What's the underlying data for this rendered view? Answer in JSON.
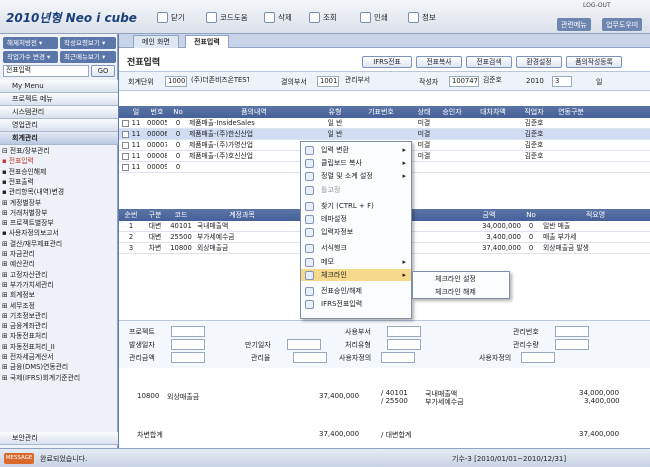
{
  "app": {
    "logo": "2010년형 Neo i cube",
    "logout": "LOG-OUT",
    "toolbar": [
      "닫기",
      "코드도움",
      "삭제",
      "조회",
      "인쇄",
      "정보"
    ],
    "header_buttons": [
      "관련메뉴",
      "업무도우미"
    ]
  },
  "sidebar": {
    "buttons": [
      "해제처방전 ▾",
      "작성요령보기 ▾",
      "작업가수 변경 ▾",
      "최근메뉴보기 ▾"
    ],
    "search_value": "전표입력",
    "go": "GO",
    "nav": [
      "My Menu",
      "프로젝트 메뉴",
      "시스템관리",
      "영업관리",
      "회계관리"
    ],
    "tree": [
      "⊟ 전표/장부관리",
      "  ▪ 전표입력",
      "  ▪ 전표승인해제",
      "  ▪ 전표출력",
      "  ▪ 관리항목(내역)변경",
      "⊞ 계정별장부",
      "⊞ 거래처별장부",
      "⊞ 프로젝트별장부",
      "  ▪ 사용자정의보고서",
      "⊞ 결산/재무제표관리",
      "⊞ 자금관리",
      "⊞ 예산관리",
      "⊞ 고정자산관리",
      "⊞ 부가가치세관리",
      "⊞ 회계정보",
      "⊞ 세무조정",
      "⊞ 기초정보관리",
      "⊞ 금융계좌관리",
      "⊞ 자동전표처리",
      "⊞ 자동전표처리_II",
      "⊞ 전자세금계산서",
      "⊞ 금융(DMS)연동관리",
      "⊞ 국제(IFRS)회계기준관리"
    ],
    "bottom": "보안관리"
  },
  "tabs": [
    "메인 화면",
    "전표입력"
  ],
  "page_title": "전표입력",
  "action_buttons": [
    "IFRS전표",
    "전표복사",
    "전표검색",
    "환경설정",
    "품의작성등록"
  ],
  "filters": {
    "unit_label": "회계단위",
    "unit_code": "1000",
    "unit_name": "(주)더존비즈온TEST",
    "dept_label": "결의부서",
    "dept_code": "1001",
    "dept_name": "관리부서",
    "writer_label": "작성자",
    "writer_code": "100747",
    "writer_name": "김준호",
    "year": "2010",
    "month": "3",
    "day_label": "일"
  },
  "top_grid": {
    "headers": [
      "일",
      "번호",
      "No",
      "품의내역",
      "유형",
      "기표번호",
      "상태",
      "승인자",
      "대차차액",
      "작업자",
      "연동구분"
    ],
    "rows": [
      [
        "11",
        "00005",
        "0",
        "제품매출-InsideSales",
        "일 반",
        "",
        "미결",
        "",
        "",
        "김준호",
        ""
      ],
      [
        "11",
        "00006",
        "0",
        "제품매출-(주)한신산업",
        "일 반",
        "",
        "미결",
        "",
        "",
        "김준호",
        ""
      ],
      [
        "11",
        "00007",
        "0",
        "제품매출-(주)가영산업",
        "일 반",
        "",
        "미결",
        "",
        "",
        "김준호",
        ""
      ],
      [
        "11",
        "00008",
        "0",
        "제품매출-(주)호신산업",
        "일 반",
        "",
        "미결",
        "",
        "",
        "김준호",
        ""
      ],
      [
        "11",
        "00009",
        "0",
        "",
        "",
        "",
        "",
        "",
        "",
        "",
        ""
      ]
    ]
  },
  "detail_grid": {
    "headers": [
      "순번",
      "구분",
      "코드",
      "계정과목",
      "",
      "금액",
      "No",
      "적요명"
    ],
    "rows": [
      [
        "1",
        "대변",
        "40101",
        "국내매출액",
        "",
        "34,000,000",
        "0",
        "일반 매출"
      ],
      [
        "2",
        "대변",
        "25500",
        "부가세예수금",
        "",
        "3,400,000",
        "0",
        "매출 부가세"
      ],
      [
        "3",
        "차변",
        "10800",
        "외상매출금",
        "",
        "37,400,000",
        "0",
        "외상매출금 발생"
      ]
    ]
  },
  "context_menu": [
    "입력 변환",
    "클립보드 복사",
    "정렬 및 소계 설정",
    "틀고정",
    "찾기 (CTRL + F)",
    "테마설정",
    "입력자정보",
    "서식행크",
    "메모",
    "체크라인",
    "전표승인/해제",
    "IFRS전표입력"
  ],
  "submenu": [
    "체크라인 설정",
    "체크라인 해제"
  ],
  "form_labels": [
    "프로젝트",
    "사용부서",
    "관리번호",
    "발생일자",
    "만기일자",
    "처리유형",
    "관리수량",
    "관리금액",
    "관리율",
    "사용자정의",
    "사용자정의"
  ],
  "summary": {
    "code": "10800",
    "name": "외상매출금",
    "amount": "37,400,000",
    "code2": "/ 40101",
    "code3": "/ 25500",
    "acct2": "국내매출액",
    "acct3": "부가세예수금",
    "amt2": "34,000,000",
    "amt3": "3,400,000",
    "total_label": "차변합계",
    "total": "37,400,000",
    "credit_label": "/ 대변합계",
    "credit_total": "37,400,000"
  },
  "status": {
    "badge": "MESSAGE",
    "text": "완료되었습니다.",
    "right": "기수-3 [2010/01/01~2010/12/31]"
  }
}
